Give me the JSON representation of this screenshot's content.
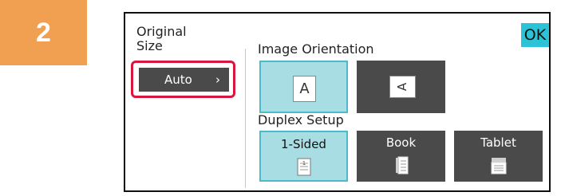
{
  "step_number": "2",
  "panel": {
    "original_size_label": "Original\nSize",
    "ok_label": "OK",
    "auto_button_label": "Auto",
    "auto_chevron": "›",
    "image_orientation_label": "Image Orientation",
    "orientation_a_glyph": "A",
    "orientation_b_glyph": "A",
    "duplex_setup_label": "Duplex Setup",
    "duplex_options": [
      {
        "label": "1-Sided",
        "selected": true,
        "icon": "one-sided-doc-icon"
      },
      {
        "label": "Book",
        "selected": false,
        "icon": "book-doc-icon"
      },
      {
        "label": "Tablet",
        "selected": false,
        "icon": "tablet-doc-icon"
      }
    ]
  },
  "colors": {
    "step_badge": "#f0a050",
    "ok": "#2cc3d6",
    "selected_fill": "#a9dde4",
    "selected_border": "#49bccb",
    "dark_button": "#4a4a4a",
    "highlight_ring": "#d9163d"
  }
}
